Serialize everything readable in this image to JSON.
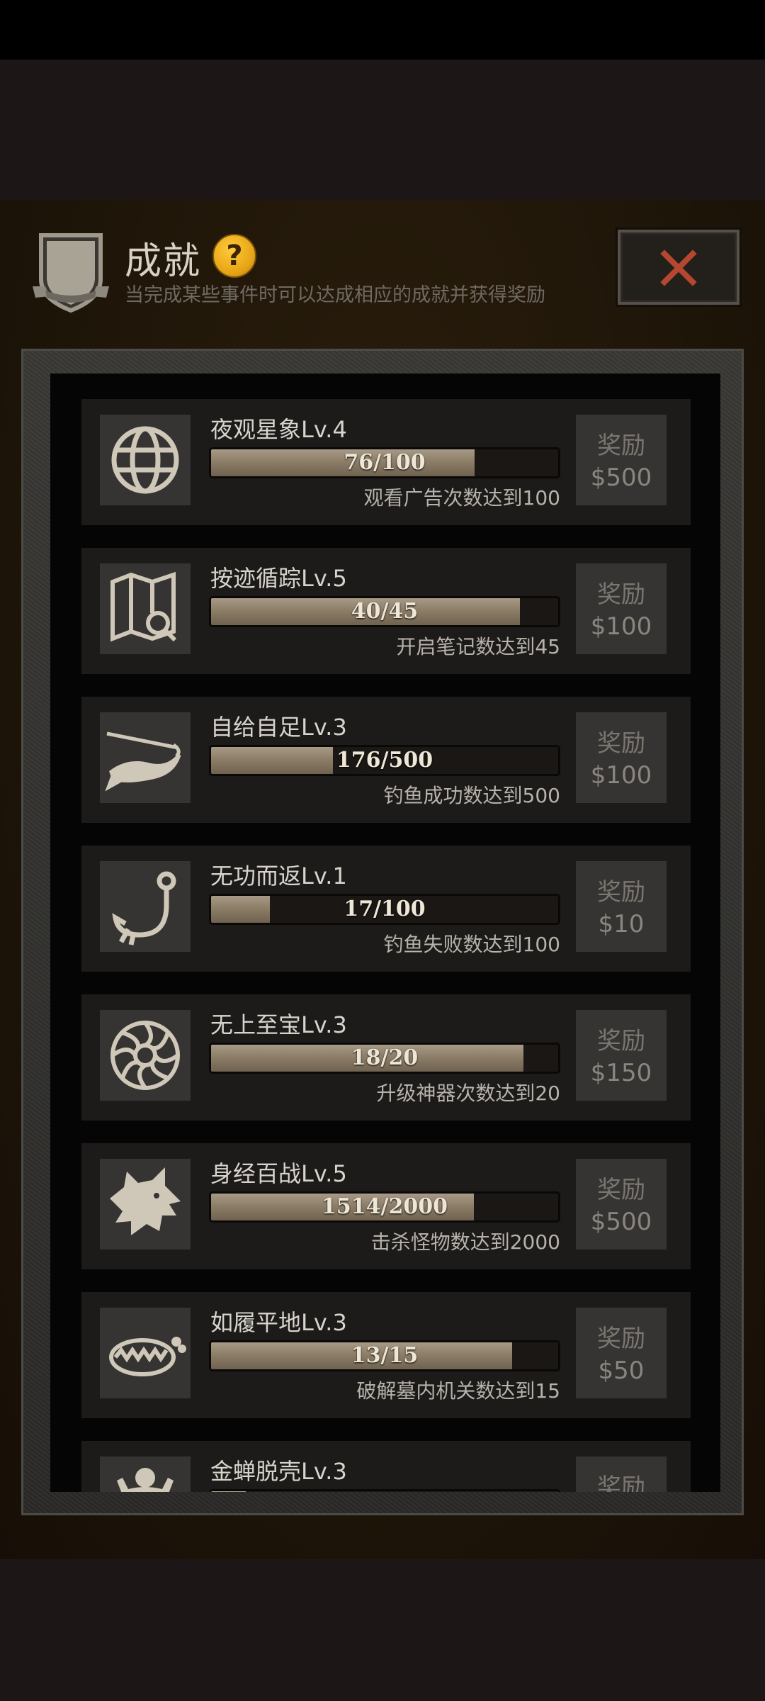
{
  "header": {
    "title": "成就",
    "help_icon_text": "?",
    "subtitle": "当完成某些事件时可以达成相应的成就并获得奖励"
  },
  "achievements": [
    {
      "name": "夜观星象Lv.4",
      "progress_text": "76/100",
      "progress": 0.76,
      "desc": "观看广告次数达到100",
      "reward_label": "奖励",
      "reward": "$500",
      "icon": "globe-icon"
    },
    {
      "name": "按迹循踪Lv.5",
      "progress_text": "40/45",
      "progress": 0.889,
      "desc": "开启笔记数达到45",
      "reward_label": "奖励",
      "reward": "$100",
      "icon": "map-search-icon"
    },
    {
      "name": "自给自足Lv.3",
      "progress_text": "176/500",
      "progress": 0.352,
      "desc": "钓鱼成功数达到500",
      "reward_label": "奖励",
      "reward": "$100",
      "icon": "fish-hook-icon"
    },
    {
      "name": "无功而返Lv.1",
      "progress_text": "17/100",
      "progress": 0.17,
      "desc": "钓鱼失败数达到100",
      "reward_label": "奖励",
      "reward": "$10",
      "icon": "hook-icon"
    },
    {
      "name": "无上至宝Lv.3",
      "progress_text": "18/20",
      "progress": 0.9,
      "desc": "升级神器次数达到20",
      "reward_label": "奖励",
      "reward": "$150",
      "icon": "artifact-emblem-icon"
    },
    {
      "name": "身经百战Lv.5",
      "progress_text": "1514/2000",
      "progress": 0.757,
      "desc": "击杀怪物数达到2000",
      "reward_label": "奖励",
      "reward": "$500",
      "icon": "wolf-head-icon"
    },
    {
      "name": "如履平地Lv.3",
      "progress_text": "13/15",
      "progress": 0.867,
      "desc": "破解墓内机关数达到15",
      "reward_label": "奖励",
      "reward": "$50",
      "icon": "bear-trap-icon"
    },
    {
      "name": "金蝉脱壳Lv.3",
      "progress_text": "",
      "progress": 0.1,
      "desc": "",
      "reward_label": "奖励",
      "reward": "",
      "icon": "figure-icon"
    }
  ]
}
